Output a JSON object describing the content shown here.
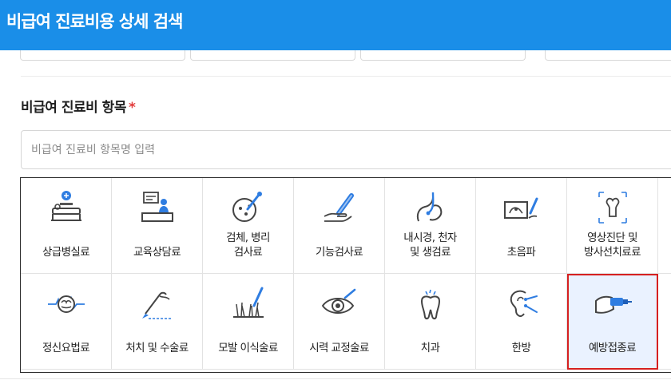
{
  "header": {
    "title": "비급여 진료비용 상세 검색"
  },
  "section": {
    "title": "비급여 진료비 항목",
    "required_mark": "*"
  },
  "search": {
    "placeholder": "비급여 진료비 항목명 입력",
    "value": ""
  },
  "categories": [
    {
      "label": "상급병실료",
      "icon": "hospital-bed-icon"
    },
    {
      "label": "교육상담료",
      "icon": "counseling-icon"
    },
    {
      "label": "검체, 병리\n검사료",
      "icon": "specimen-test-icon"
    },
    {
      "label": "기능검사료",
      "icon": "function-test-icon"
    },
    {
      "label": "내시경, 천자\n및 생검료",
      "icon": "endoscope-icon"
    },
    {
      "label": "초음파",
      "icon": "ultrasound-icon"
    },
    {
      "label": "영상진단 및\n방사선치료료",
      "icon": "xray-icon"
    },
    {
      "label": "정신요법료",
      "icon": "brain-wave-icon"
    },
    {
      "label": "처치 및 수술료",
      "icon": "scalpel-icon"
    },
    {
      "label": "모발 이식술료",
      "icon": "hair-transplant-icon"
    },
    {
      "label": "시력 교정술료",
      "icon": "eye-icon"
    },
    {
      "label": "치과",
      "icon": "tooth-icon"
    },
    {
      "label": "한방",
      "icon": "acupuncture-ear-icon"
    },
    {
      "label": "예방접종료",
      "icon": "vaccine-icon"
    }
  ],
  "selected_category": "예방접종료",
  "colors": {
    "header_bg": "#1a8ee8",
    "accent": "#1a8ee8",
    "required": "#e23b3b",
    "selected_border": "#d62020",
    "icon_blue": "#2f7de1"
  }
}
